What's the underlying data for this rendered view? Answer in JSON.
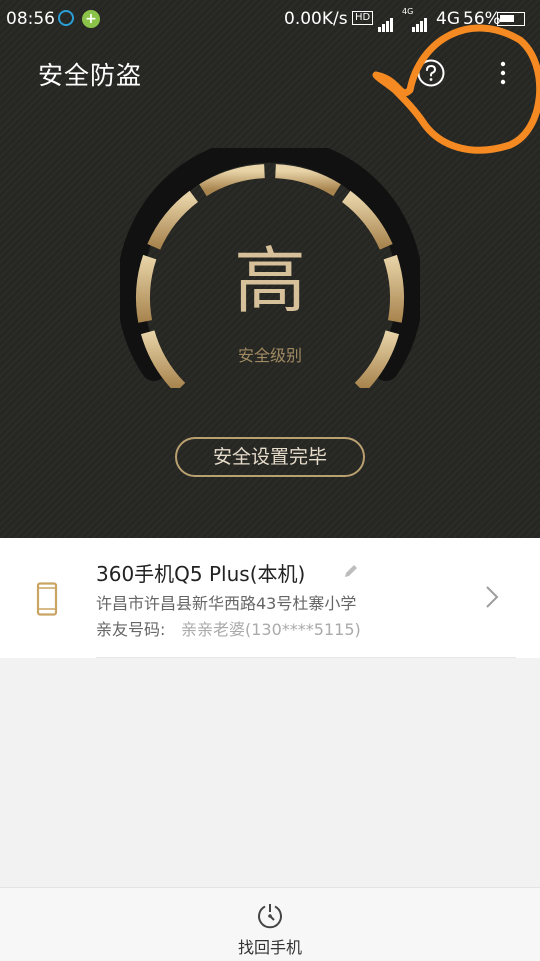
{
  "status_bar": {
    "time": "08:56",
    "net_speed": "0.00K/s",
    "hd": "HD",
    "net_small": "4G",
    "net_type": "4G",
    "battery_text": "56%"
  },
  "header": {
    "title": "安全防盗",
    "help_icon": "question-circle-icon",
    "more_icon": "more-vertical-icon"
  },
  "security": {
    "level": "高",
    "level_label": "安全级别",
    "status_button": "安全设置完毕",
    "gauge_fill": 1.0,
    "accent_color": "#d6c19a"
  },
  "device": {
    "name": "360手机Q5 Plus(本机)",
    "location": "许昌市许昌县新华西路43号杜寨小学",
    "contact_label": "亲友号码:",
    "contact_value": "亲亲老婆(130****5115)"
  },
  "bottom_bar": {
    "find_phone_label": "找回手机"
  }
}
